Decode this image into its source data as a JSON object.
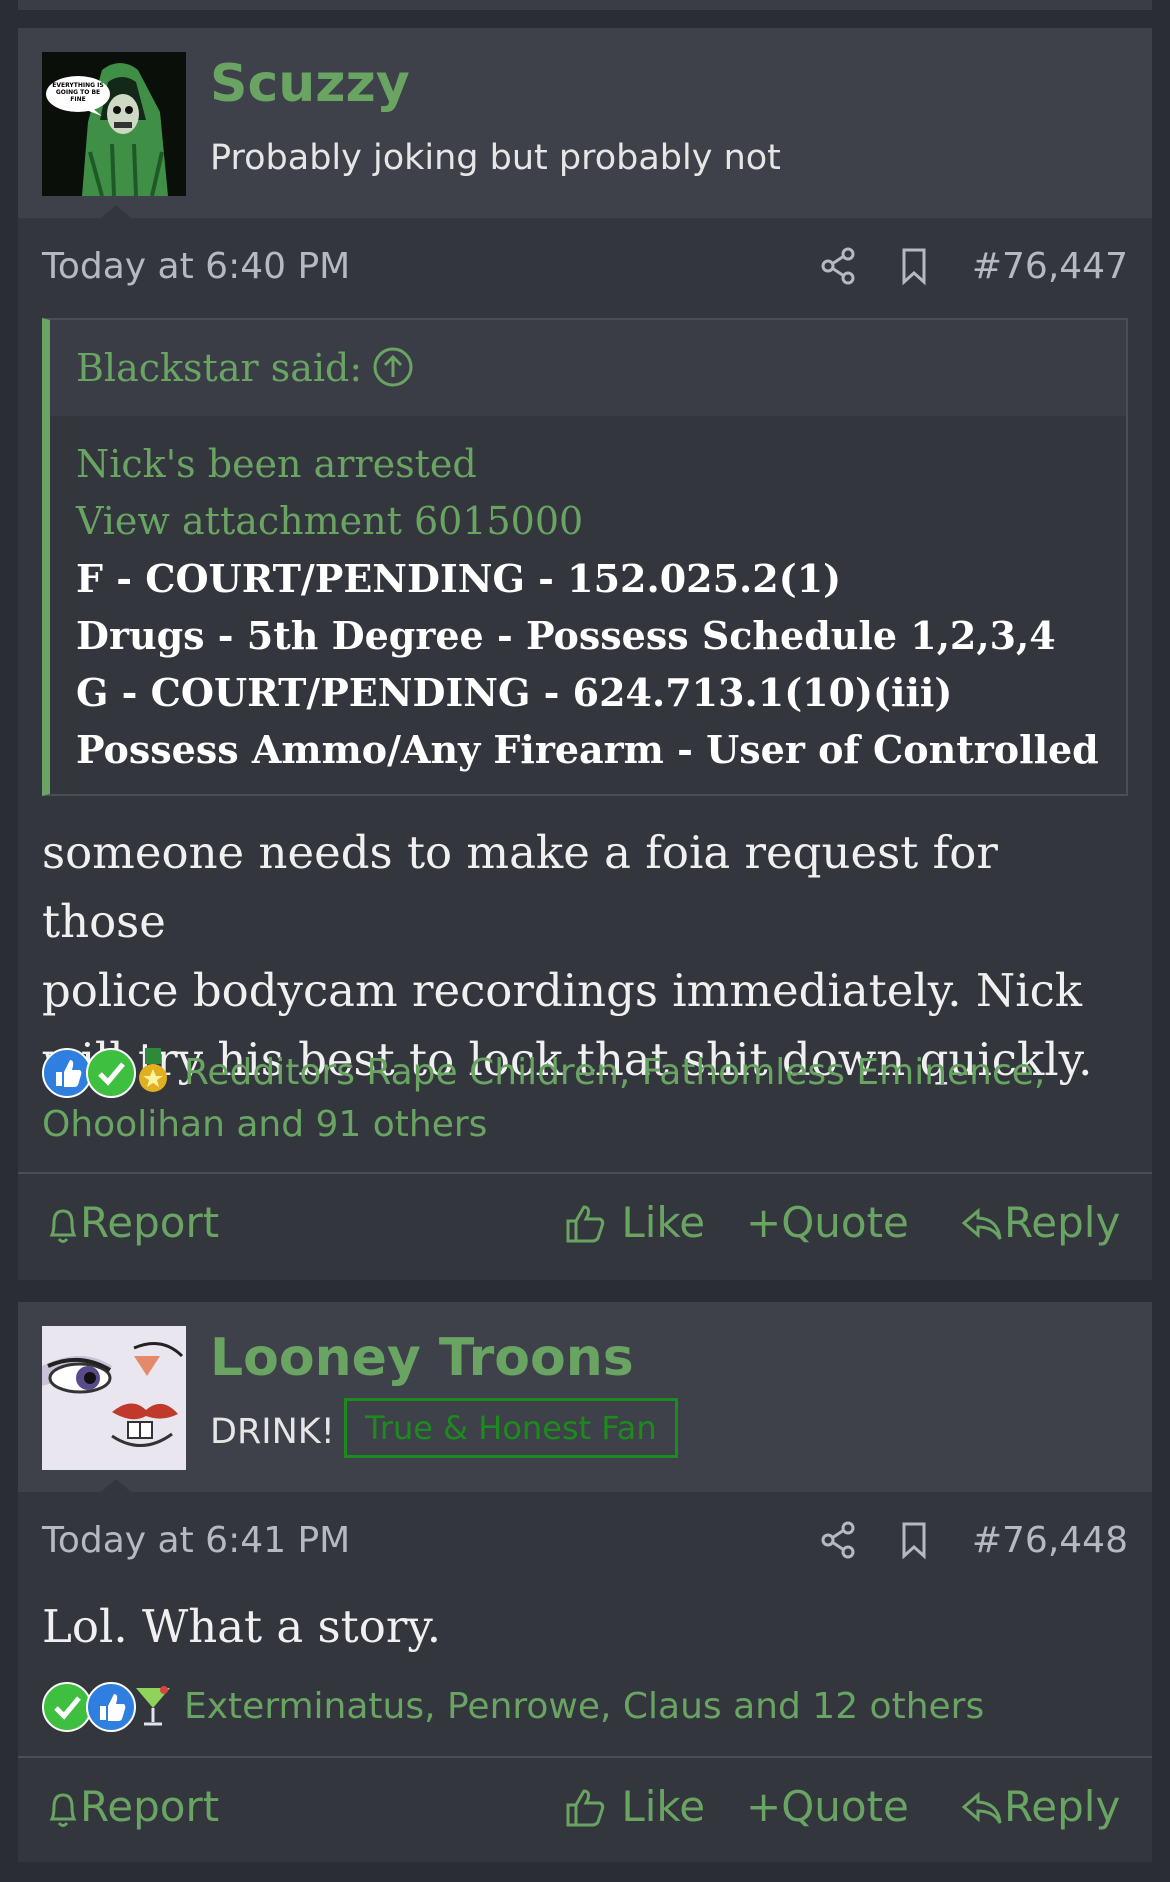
{
  "colors": {
    "accent": "#69a463",
    "background": "#2a2d33",
    "card": "#33363d",
    "header": "#3e4149",
    "badge": "#1d8a1d"
  },
  "posts": [
    {
      "username": "Scuzzy",
      "user_title": "Probably joking but probably not",
      "avatar_caption": "EVERYTHING IS GOING TO BE FINE",
      "timestamp": "Today at 6:40 PM",
      "post_number": "#76,447",
      "quote": {
        "author": "Blackstar said:",
        "lines": [
          "Nick's been arrested",
          "View attachment 6015000",
          "F - COURT/PENDING - 152.025.2(1)",
          "Drugs - 5th Degree - Possess Schedule 1,2,3,4",
          "G - COURT/PENDING - 624.713.1(10)(iii)",
          "Possess Ammo/Any Firearm - User of Controlled"
        ]
      },
      "body_lines": [
        "someone needs to make a foia request for those",
        "police bodycam recordings immediately. Nick",
        "will try his best to lock that shit down quickly."
      ],
      "reactions": {
        "icons": [
          "like-icon",
          "check-icon",
          "medal-icon"
        ],
        "text_line1": "Redditors Rape Children, Fathomless Eminence,",
        "text_line2": "Ohoolihan and 91 others"
      },
      "actions": {
        "report": "Report",
        "like": "Like",
        "quote": "Quote",
        "reply": "Reply"
      }
    },
    {
      "username": "Looney Troons",
      "user_title": "DRINK!",
      "badge": "True & Honest Fan",
      "timestamp": "Today at 6:41 PM",
      "post_number": "#76,448",
      "body_lines": [
        "Lol. What a story."
      ],
      "reactions": {
        "icons": [
          "check-icon",
          "like-icon",
          "cocktail-icon"
        ],
        "text_line1": "Exterminatus, Penrowe, Claus and 12 others"
      },
      "actions": {
        "report": "Report",
        "like": "Like",
        "quote": "Quote",
        "reply": "Reply"
      }
    }
  ]
}
